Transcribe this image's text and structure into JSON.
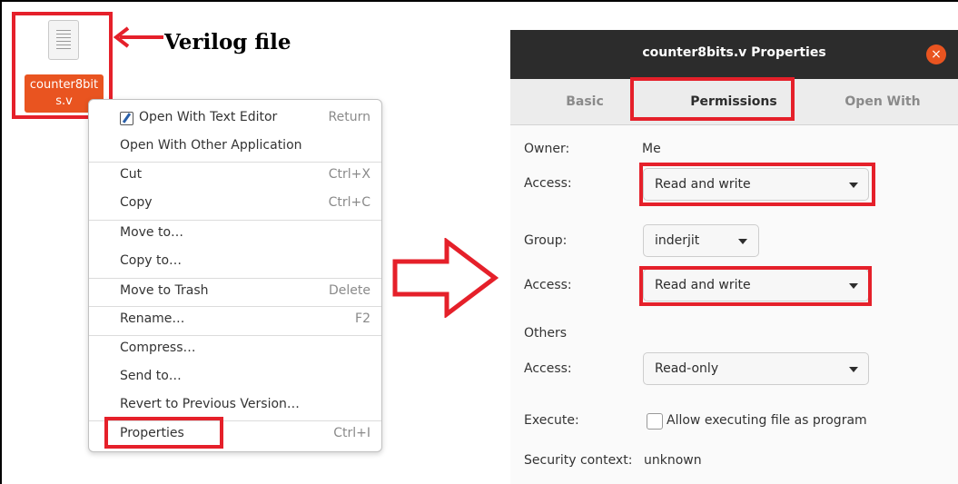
{
  "desktop": {
    "file_name": "counter8bits.v",
    "file_label_line1": "counter8bit",
    "file_label_line2": "s.v",
    "callout": "Verilog file"
  },
  "context_menu": {
    "items": [
      {
        "label": "Open With Text Editor",
        "accel": "Return",
        "icon": "text-editor-icon"
      },
      {
        "label": "Open With Other Application",
        "accel": ""
      },
      {
        "label": "Cut",
        "accel": "Ctrl+X"
      },
      {
        "label": "Copy",
        "accel": "Ctrl+C"
      },
      {
        "label": "Move to…",
        "accel": ""
      },
      {
        "label": "Copy to…",
        "accel": ""
      },
      {
        "label": "Move to Trash",
        "accel": "Delete"
      },
      {
        "label": "Rename…",
        "accel": "F2"
      },
      {
        "label": "Compress…",
        "accel": ""
      },
      {
        "label": "Send to…",
        "accel": ""
      },
      {
        "label": "Revert to Previous Version…",
        "accel": ""
      },
      {
        "label": "Properties",
        "accel": "Ctrl+I"
      }
    ]
  },
  "dialog": {
    "title": "counter8bits.v Properties",
    "close_glyph": "×",
    "tabs": [
      "Basic",
      "Permissions",
      "Open With"
    ],
    "active_tab": "Permissions",
    "owner_label": "Owner:",
    "owner_value": "Me",
    "owner_access_label": "Access:",
    "owner_access": "Read and write",
    "group_label": "Group:",
    "group_value": "inderjit",
    "group_access_label": "Access:",
    "group_access": "Read and write",
    "others_label": "Others",
    "others_access_label": "Access:",
    "others_access": "Read-only",
    "execute_label": "Execute:",
    "execute_checkbox": "Allow executing file as program",
    "execute_checked": false,
    "security_label": "Security context:",
    "security_value": "unknown"
  },
  "colors": {
    "highlight_box": "#e5202a",
    "accent_orange": "#e95420",
    "titlebar": "#2c2c2c"
  }
}
